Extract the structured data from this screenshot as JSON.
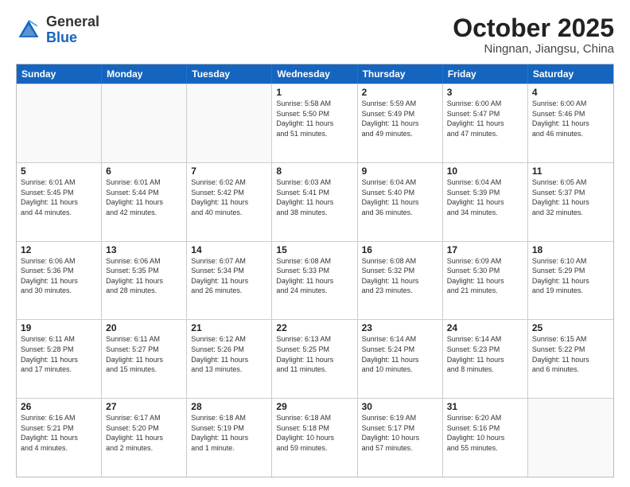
{
  "logo": {
    "general": "General",
    "blue": "Blue"
  },
  "header": {
    "month": "October 2025",
    "location": "Ningnan, Jiangsu, China"
  },
  "weekdays": [
    "Sunday",
    "Monday",
    "Tuesday",
    "Wednesday",
    "Thursday",
    "Friday",
    "Saturday"
  ],
  "rows": [
    [
      {
        "day": "",
        "info": ""
      },
      {
        "day": "",
        "info": ""
      },
      {
        "day": "",
        "info": ""
      },
      {
        "day": "1",
        "info": "Sunrise: 5:58 AM\nSunset: 5:50 PM\nDaylight: 11 hours\nand 51 minutes."
      },
      {
        "day": "2",
        "info": "Sunrise: 5:59 AM\nSunset: 5:49 PM\nDaylight: 11 hours\nand 49 minutes."
      },
      {
        "day": "3",
        "info": "Sunrise: 6:00 AM\nSunset: 5:47 PM\nDaylight: 11 hours\nand 47 minutes."
      },
      {
        "day": "4",
        "info": "Sunrise: 6:00 AM\nSunset: 5:46 PM\nDaylight: 11 hours\nand 46 minutes."
      }
    ],
    [
      {
        "day": "5",
        "info": "Sunrise: 6:01 AM\nSunset: 5:45 PM\nDaylight: 11 hours\nand 44 minutes."
      },
      {
        "day": "6",
        "info": "Sunrise: 6:01 AM\nSunset: 5:44 PM\nDaylight: 11 hours\nand 42 minutes."
      },
      {
        "day": "7",
        "info": "Sunrise: 6:02 AM\nSunset: 5:42 PM\nDaylight: 11 hours\nand 40 minutes."
      },
      {
        "day": "8",
        "info": "Sunrise: 6:03 AM\nSunset: 5:41 PM\nDaylight: 11 hours\nand 38 minutes."
      },
      {
        "day": "9",
        "info": "Sunrise: 6:04 AM\nSunset: 5:40 PM\nDaylight: 11 hours\nand 36 minutes."
      },
      {
        "day": "10",
        "info": "Sunrise: 6:04 AM\nSunset: 5:39 PM\nDaylight: 11 hours\nand 34 minutes."
      },
      {
        "day": "11",
        "info": "Sunrise: 6:05 AM\nSunset: 5:37 PM\nDaylight: 11 hours\nand 32 minutes."
      }
    ],
    [
      {
        "day": "12",
        "info": "Sunrise: 6:06 AM\nSunset: 5:36 PM\nDaylight: 11 hours\nand 30 minutes."
      },
      {
        "day": "13",
        "info": "Sunrise: 6:06 AM\nSunset: 5:35 PM\nDaylight: 11 hours\nand 28 minutes."
      },
      {
        "day": "14",
        "info": "Sunrise: 6:07 AM\nSunset: 5:34 PM\nDaylight: 11 hours\nand 26 minutes."
      },
      {
        "day": "15",
        "info": "Sunrise: 6:08 AM\nSunset: 5:33 PM\nDaylight: 11 hours\nand 24 minutes."
      },
      {
        "day": "16",
        "info": "Sunrise: 6:08 AM\nSunset: 5:32 PM\nDaylight: 11 hours\nand 23 minutes."
      },
      {
        "day": "17",
        "info": "Sunrise: 6:09 AM\nSunset: 5:30 PM\nDaylight: 11 hours\nand 21 minutes."
      },
      {
        "day": "18",
        "info": "Sunrise: 6:10 AM\nSunset: 5:29 PM\nDaylight: 11 hours\nand 19 minutes."
      }
    ],
    [
      {
        "day": "19",
        "info": "Sunrise: 6:11 AM\nSunset: 5:28 PM\nDaylight: 11 hours\nand 17 minutes."
      },
      {
        "day": "20",
        "info": "Sunrise: 6:11 AM\nSunset: 5:27 PM\nDaylight: 11 hours\nand 15 minutes."
      },
      {
        "day": "21",
        "info": "Sunrise: 6:12 AM\nSunset: 5:26 PM\nDaylight: 11 hours\nand 13 minutes."
      },
      {
        "day": "22",
        "info": "Sunrise: 6:13 AM\nSunset: 5:25 PM\nDaylight: 11 hours\nand 11 minutes."
      },
      {
        "day": "23",
        "info": "Sunrise: 6:14 AM\nSunset: 5:24 PM\nDaylight: 11 hours\nand 10 minutes."
      },
      {
        "day": "24",
        "info": "Sunrise: 6:14 AM\nSunset: 5:23 PM\nDaylight: 11 hours\nand 8 minutes."
      },
      {
        "day": "25",
        "info": "Sunrise: 6:15 AM\nSunset: 5:22 PM\nDaylight: 11 hours\nand 6 minutes."
      }
    ],
    [
      {
        "day": "26",
        "info": "Sunrise: 6:16 AM\nSunset: 5:21 PM\nDaylight: 11 hours\nand 4 minutes."
      },
      {
        "day": "27",
        "info": "Sunrise: 6:17 AM\nSunset: 5:20 PM\nDaylight: 11 hours\nand 2 minutes."
      },
      {
        "day": "28",
        "info": "Sunrise: 6:18 AM\nSunset: 5:19 PM\nDaylight: 11 hours\nand 1 minute."
      },
      {
        "day": "29",
        "info": "Sunrise: 6:18 AM\nSunset: 5:18 PM\nDaylight: 10 hours\nand 59 minutes."
      },
      {
        "day": "30",
        "info": "Sunrise: 6:19 AM\nSunset: 5:17 PM\nDaylight: 10 hours\nand 57 minutes."
      },
      {
        "day": "31",
        "info": "Sunrise: 6:20 AM\nSunset: 5:16 PM\nDaylight: 10 hours\nand 55 minutes."
      },
      {
        "day": "",
        "info": ""
      }
    ]
  ]
}
